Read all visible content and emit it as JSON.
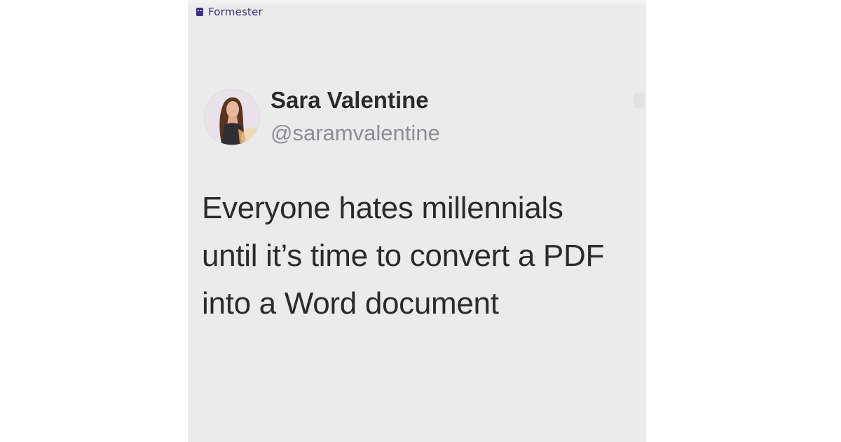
{
  "brand": {
    "name": "Formester",
    "icon": "robot-logo-icon",
    "color": "#3a2f86"
  },
  "tweet": {
    "author_name": "Sara Valentine",
    "author_handle": "@saramvalentine",
    "avatar_icon": "avatar-photo",
    "text_lines": [
      "Everyone hates millennials",
      "until it’s time to convert a PDF",
      "into a Word document"
    ]
  },
  "colors": {
    "card_background": "#ebebeb",
    "text": "#2b2b2b",
    "handle": "#8d8d95"
  }
}
